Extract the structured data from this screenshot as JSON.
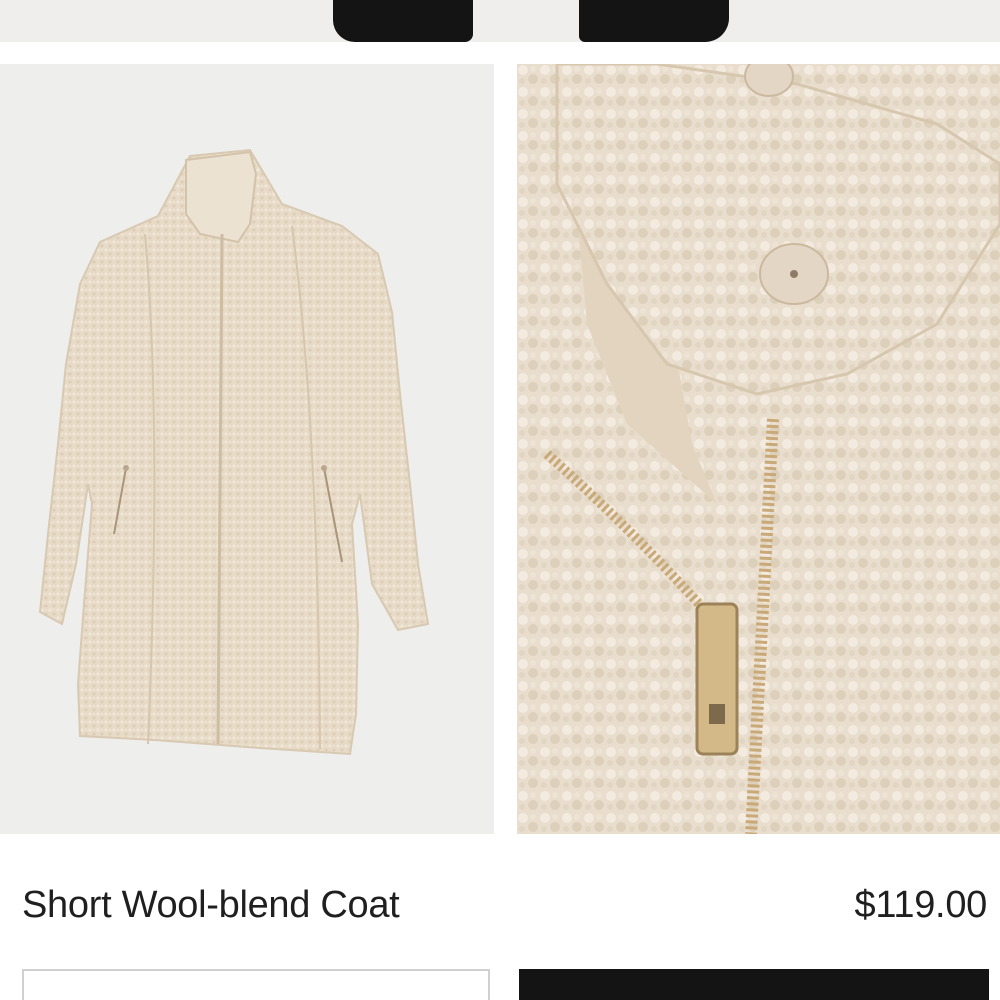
{
  "product": {
    "name": "Short Wool-blend Coat",
    "price": "$119.00"
  },
  "gallery": {
    "images": [
      {
        "name": "front-view"
      },
      {
        "name": "detail-closeup"
      }
    ]
  },
  "colors": {
    "coat": "#e6d9c5",
    "background": "#eeeeec",
    "button_dark": "#141414"
  }
}
